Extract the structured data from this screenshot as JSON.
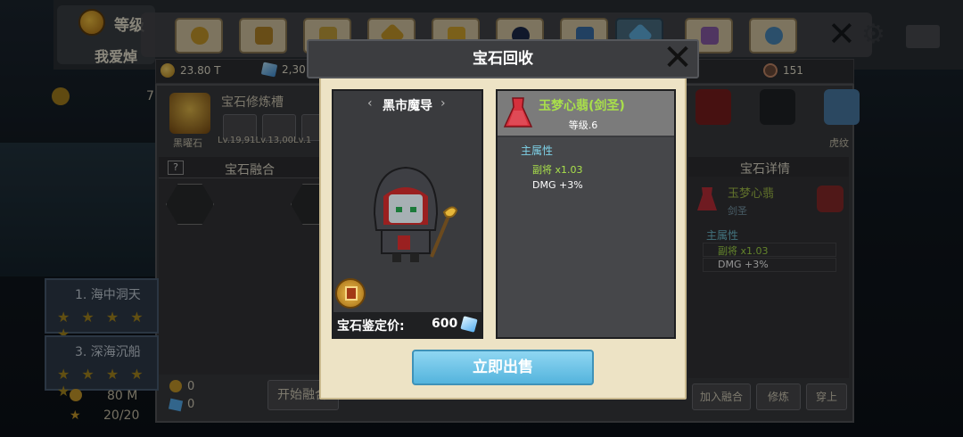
{
  "header": {
    "player_level_label": "等级",
    "player_name": "我爱焯"
  },
  "tabs": [
    "avatar",
    "helmet",
    "fence",
    "sword",
    "trophy",
    "orb",
    "fish",
    "crystal",
    "shirt",
    "friends"
  ],
  "currency": {
    "gold": "23.80 T",
    "gems": "2,30",
    "gears": "151"
  },
  "gem_slots": {
    "title": "宝石修炼槽",
    "avatar_label": "黑曜石",
    "levels": "Lv.19,91Lv.13,00Lv.1"
  },
  "fusion": {
    "help": "?",
    "title": "宝石融合",
    "count1": "0",
    "count2": "0",
    "start_label": "开始融合"
  },
  "stages": [
    {
      "label": "1. 海中洞天",
      "stars": "★ ★ ★ ★ ★"
    },
    {
      "label": "3. 深海沉船",
      "stars": "★ ★ ★ ★ ★"
    }
  ],
  "left_stats": {
    "gold": "80 M",
    "stars": "20/20",
    "partial_number": "7"
  },
  "right_detail": {
    "title": "宝石详情",
    "gem_name": "玉梦心翡",
    "gem_sub": "剑圣",
    "main_attr": "主属性",
    "attr1": "副将 x1.03",
    "attr2": "DMG +3%",
    "beast_label": "虎纹",
    "buttons": [
      "加入融合",
      "修炼",
      "穿上"
    ]
  },
  "modal": {
    "title": "宝石回收",
    "close_icon": "close-x",
    "merchant_name": "黑市魔导",
    "price_label": "宝石鉴定价:",
    "price_value": "600",
    "gem_name": "玉梦心翡(剑圣)",
    "gem_level": "等级.6",
    "main_attr_title": "主属性",
    "attr_1": "副将 x1.03",
    "attr_2": "DMG +3%",
    "sell_button": "立即出售"
  },
  "colors": {
    "modal_bg": "#ede3c5",
    "accent_blue": "#54b4dd",
    "attr_green": "#a9e04a",
    "attr_cyan": "#7ed2e8"
  }
}
